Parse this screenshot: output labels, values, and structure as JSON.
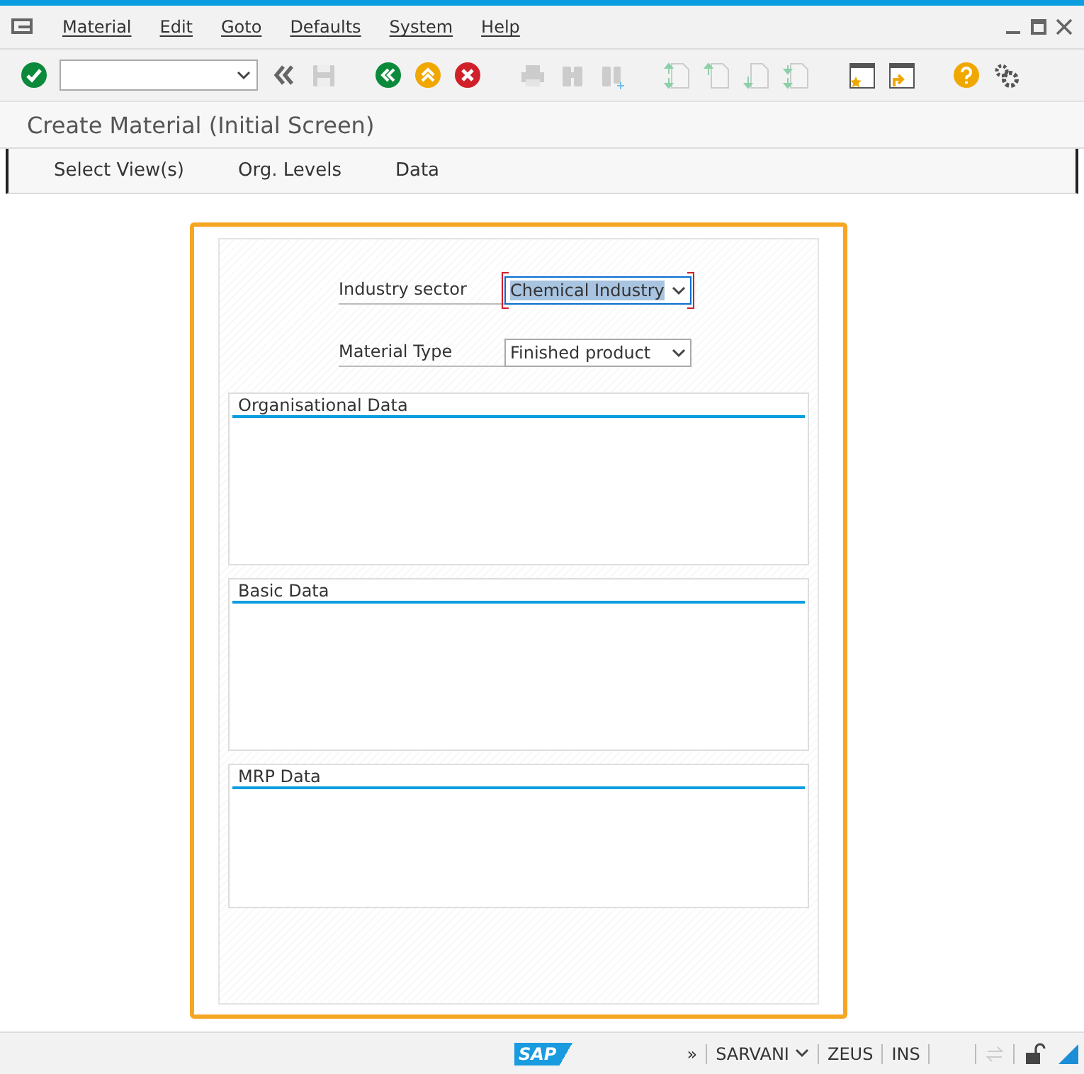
{
  "menu_bar": {
    "items": [
      "Material",
      "Edit",
      "Goto",
      "Defaults",
      "System",
      "Help"
    ]
  },
  "toolbar": {
    "buttons": [
      {
        "kind": "enter"
      },
      {
        "kind": "command"
      },
      {
        "kind": "collapse"
      },
      {
        "kind": "save"
      },
      {
        "kind": "back"
      },
      {
        "kind": "exit"
      },
      {
        "kind": "cancel"
      },
      {
        "kind": "print"
      },
      {
        "kind": "find"
      },
      {
        "kind": "find-next"
      },
      {
        "kind": "first-page"
      },
      {
        "kind": "prev-page"
      },
      {
        "kind": "next-page"
      },
      {
        "kind": "last-page"
      },
      {
        "kind": "new-session"
      },
      {
        "kind": "shortcut"
      },
      {
        "kind": "help"
      },
      {
        "kind": "layout"
      }
    ]
  },
  "title": "Create Material (Initial Screen)",
  "app_toolbar": {
    "items": [
      "Select View(s)",
      "Org. Levels",
      "Data"
    ]
  },
  "form": {
    "fields": [
      {
        "label": "Industry sector",
        "value": "Chemical Industry",
        "focused": true
      },
      {
        "label": "Material Type",
        "value": "Finished product",
        "focused": false
      }
    ],
    "groups": [
      {
        "title": "Organisational Data"
      },
      {
        "title": "Basic Data"
      },
      {
        "title": "MRP Data"
      }
    ]
  },
  "status_bar": {
    "logo": "SAP",
    "expand": "»",
    "user": "SARVANI",
    "system": "ZEUS",
    "mode": "INS"
  }
}
